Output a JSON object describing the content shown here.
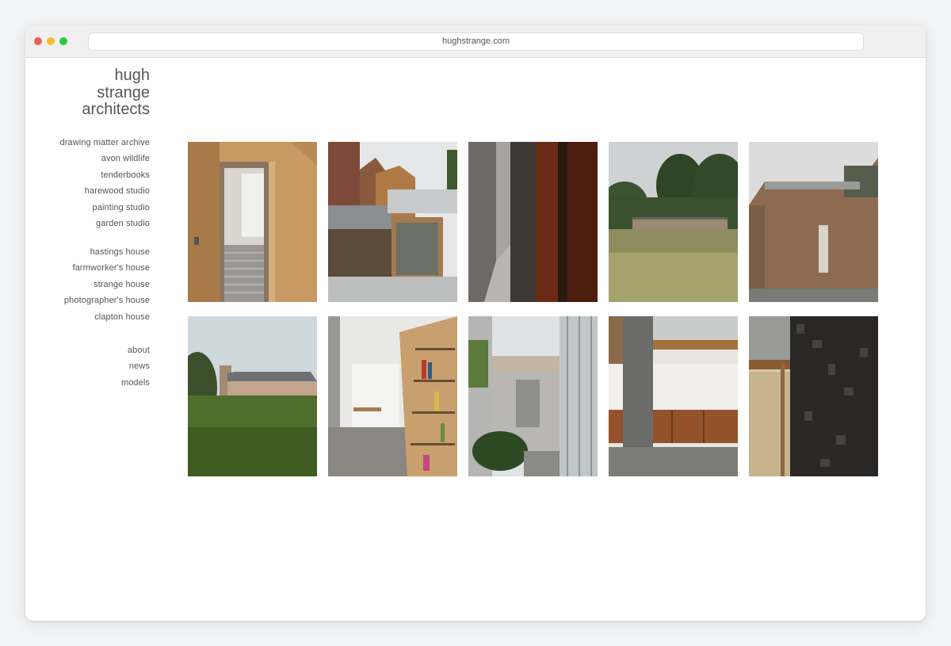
{
  "browser": {
    "url": "hughstrange.com",
    "traffic_lights": {
      "close": "#ee5f57",
      "minimize": "#f6bd2f",
      "maximize": "#2ac840"
    }
  },
  "site": {
    "logo_lines": [
      "hugh",
      "strange",
      "architects"
    ]
  },
  "nav": {
    "group1": [
      "drawing matter archive",
      "avon wildlife",
      "tenderbooks",
      "harewood studio",
      "painting studio",
      "garden studio"
    ],
    "group2": [
      "hastings house",
      "farmworker's house",
      "strange house",
      "photographer's house",
      "clapton house"
    ],
    "group3": [
      "about",
      "news",
      "models"
    ]
  },
  "gallery": [
    {
      "icon": "timber-interior-photo"
    },
    {
      "icon": "brick-extension-photo"
    },
    {
      "icon": "narrow-passage-photo"
    },
    {
      "icon": "meadow-pavilion-photo"
    },
    {
      "icon": "brick-house-photo"
    },
    {
      "icon": "farmhouse-field-photo"
    },
    {
      "icon": "bookshelf-gallery-photo"
    },
    {
      "icon": "glass-courtyard-photo"
    },
    {
      "icon": "whitewashed-wall-photo"
    },
    {
      "icon": "charred-timber-photo"
    }
  ]
}
